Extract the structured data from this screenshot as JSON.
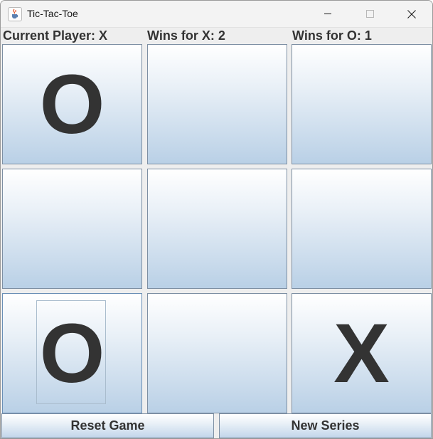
{
  "window": {
    "title": "Tic-Tac-Toe",
    "icon": "java-cup-icon"
  },
  "status": {
    "current_player": "Current Player: X",
    "wins_x": "Wins for X: 2",
    "wins_o": "Wins for O: 1"
  },
  "board": {
    "cells": [
      "O",
      "",
      "",
      "",
      "",
      "",
      "O",
      "",
      "X"
    ]
  },
  "buttons": {
    "reset": "Reset Game",
    "new_series": "New Series"
  },
  "colors": {
    "mark": "#333333",
    "cell_top": "#ffffff",
    "cell_bottom": "#b9d0e6",
    "cell_border": "#7d8fa3"
  }
}
